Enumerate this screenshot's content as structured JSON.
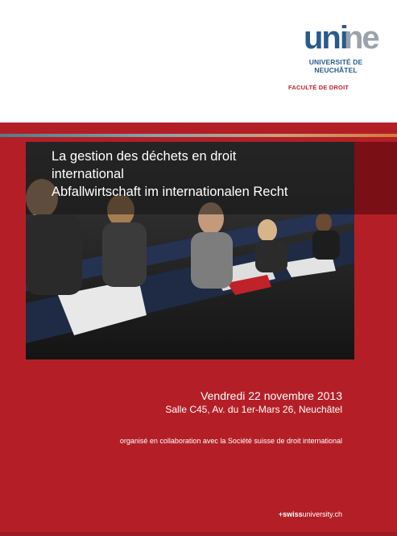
{
  "header": {
    "logo_wordmark": "unine",
    "university_line1": "UNIVERSITÉ DE",
    "university_line2": "NEUCHÂTEL",
    "faculty": "FACULTÉ DE DROIT"
  },
  "event": {
    "title_line1": "La gestion des déchets en droit",
    "title_line2": "international",
    "title_line3": "Abfallwirtschaft im internationalen Recht",
    "date": "Vendredi 22 novembre 2013",
    "venue": "Salle C45, Av. du 1er-Mars 26, Neuchâtel",
    "collaboration": "organisé en collaboration avec la Société suisse de droit international"
  },
  "footer": {
    "swissuni_prefix": "+swiss",
    "swissuni_suffix": "university.ch"
  },
  "colors": {
    "brand_red": "#b41f27",
    "dark_red": "#7a0f16",
    "unine_blue": "#2a5a8a",
    "unine_grey": "#9aa3ab"
  },
  "icons": [
    "unine-logo-icon",
    "lecture-hall-photo"
  ]
}
